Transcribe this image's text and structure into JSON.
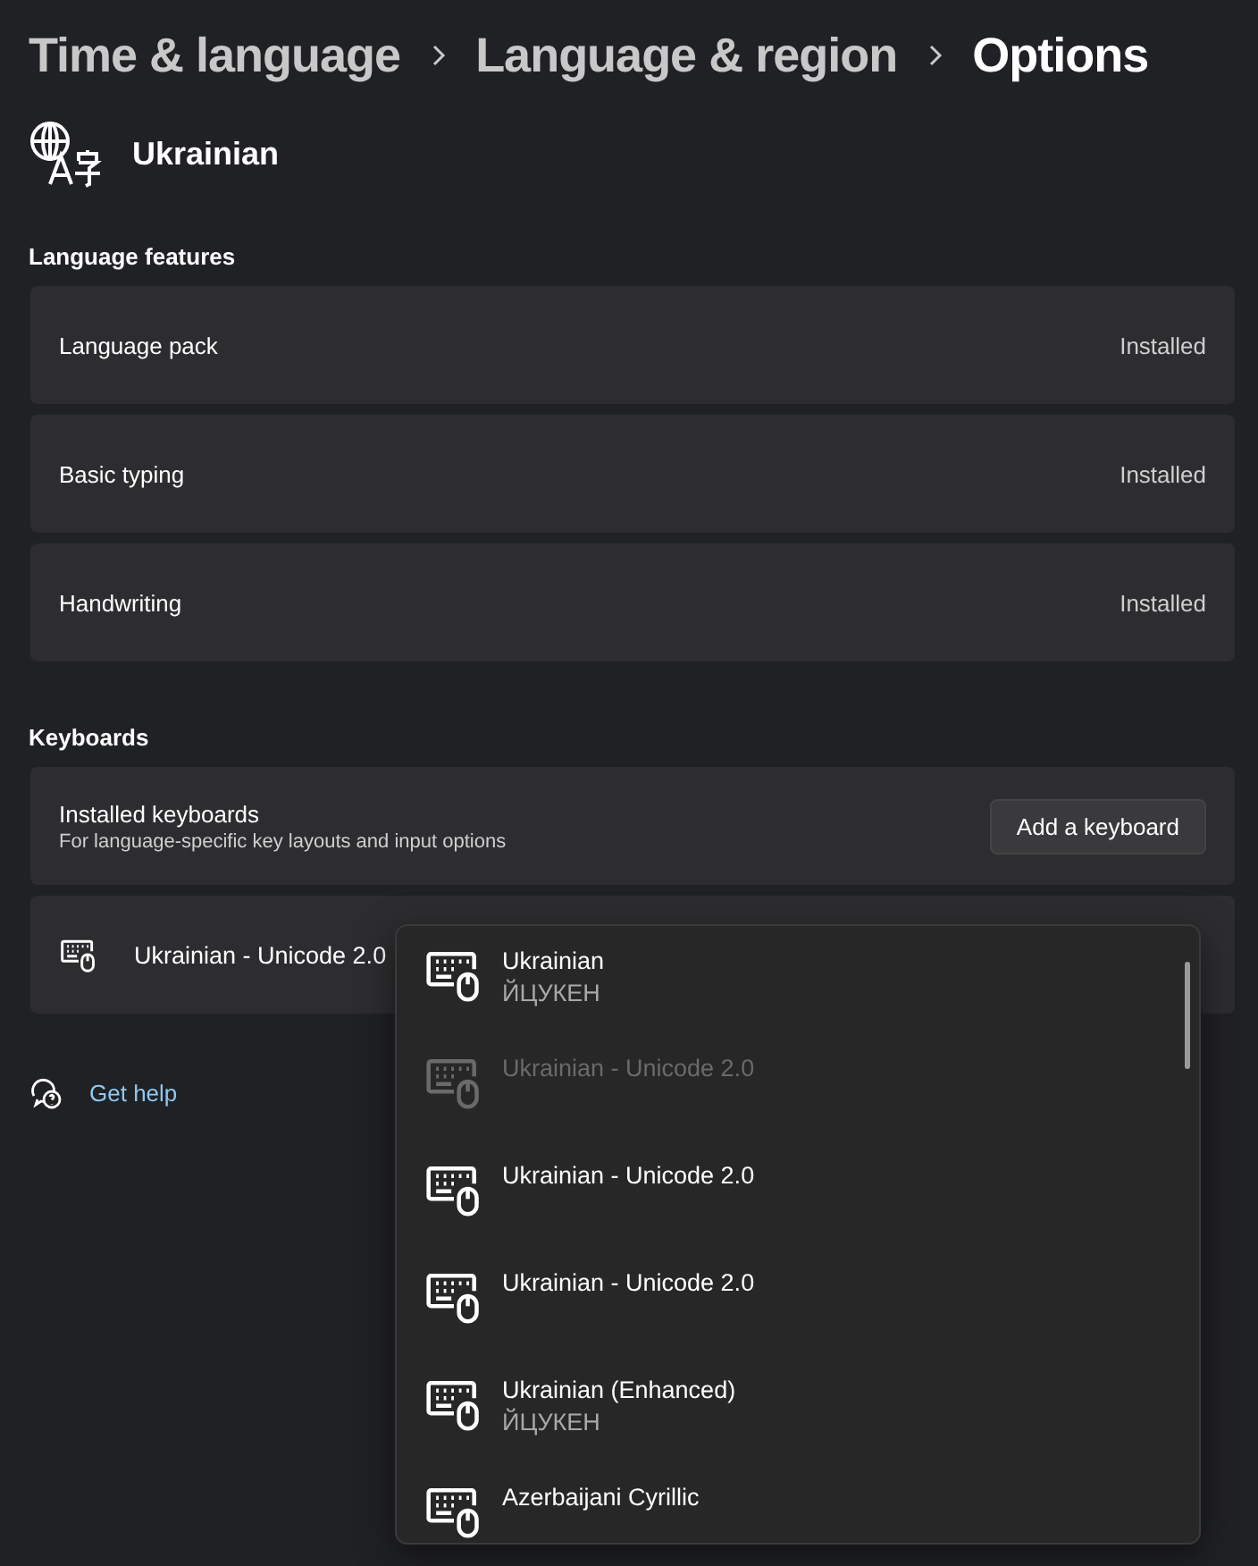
{
  "breadcrumb": [
    {
      "label": "Time & language",
      "current": false
    },
    {
      "label": "Language & region",
      "current": false
    },
    {
      "label": "Options",
      "current": true
    }
  ],
  "language": "Ukrainian",
  "features": {
    "heading": "Language features",
    "items": [
      {
        "label": "Language pack",
        "status": "Installed"
      },
      {
        "label": "Basic typing",
        "status": "Installed"
      },
      {
        "label": "Handwriting",
        "status": "Installed"
      }
    ]
  },
  "keyboards": {
    "heading": "Keyboards",
    "title": "Installed keyboards",
    "description": "For language-specific key layouts and input options",
    "button": "Add a keyboard",
    "installed": [
      {
        "label": "Ukrainian - Unicode 2.0"
      }
    ]
  },
  "help_link": "Get help",
  "dropdown": {
    "items": [
      {
        "label": "Ukrainian",
        "sublabel": "ЙЦУКЕН",
        "disabled": false
      },
      {
        "label": "Ukrainian - Unicode 2.0",
        "disabled": true
      },
      {
        "label": "Ukrainian - Unicode 2.0",
        "disabled": false
      },
      {
        "label": "Ukrainian - Unicode 2.0",
        "disabled": false
      },
      {
        "label": "Ukrainian (Enhanced)",
        "sublabel": "ЙЦУКЕН",
        "disabled": false
      },
      {
        "label": "Azerbaijani Cyrillic",
        "disabled": false
      }
    ]
  }
}
